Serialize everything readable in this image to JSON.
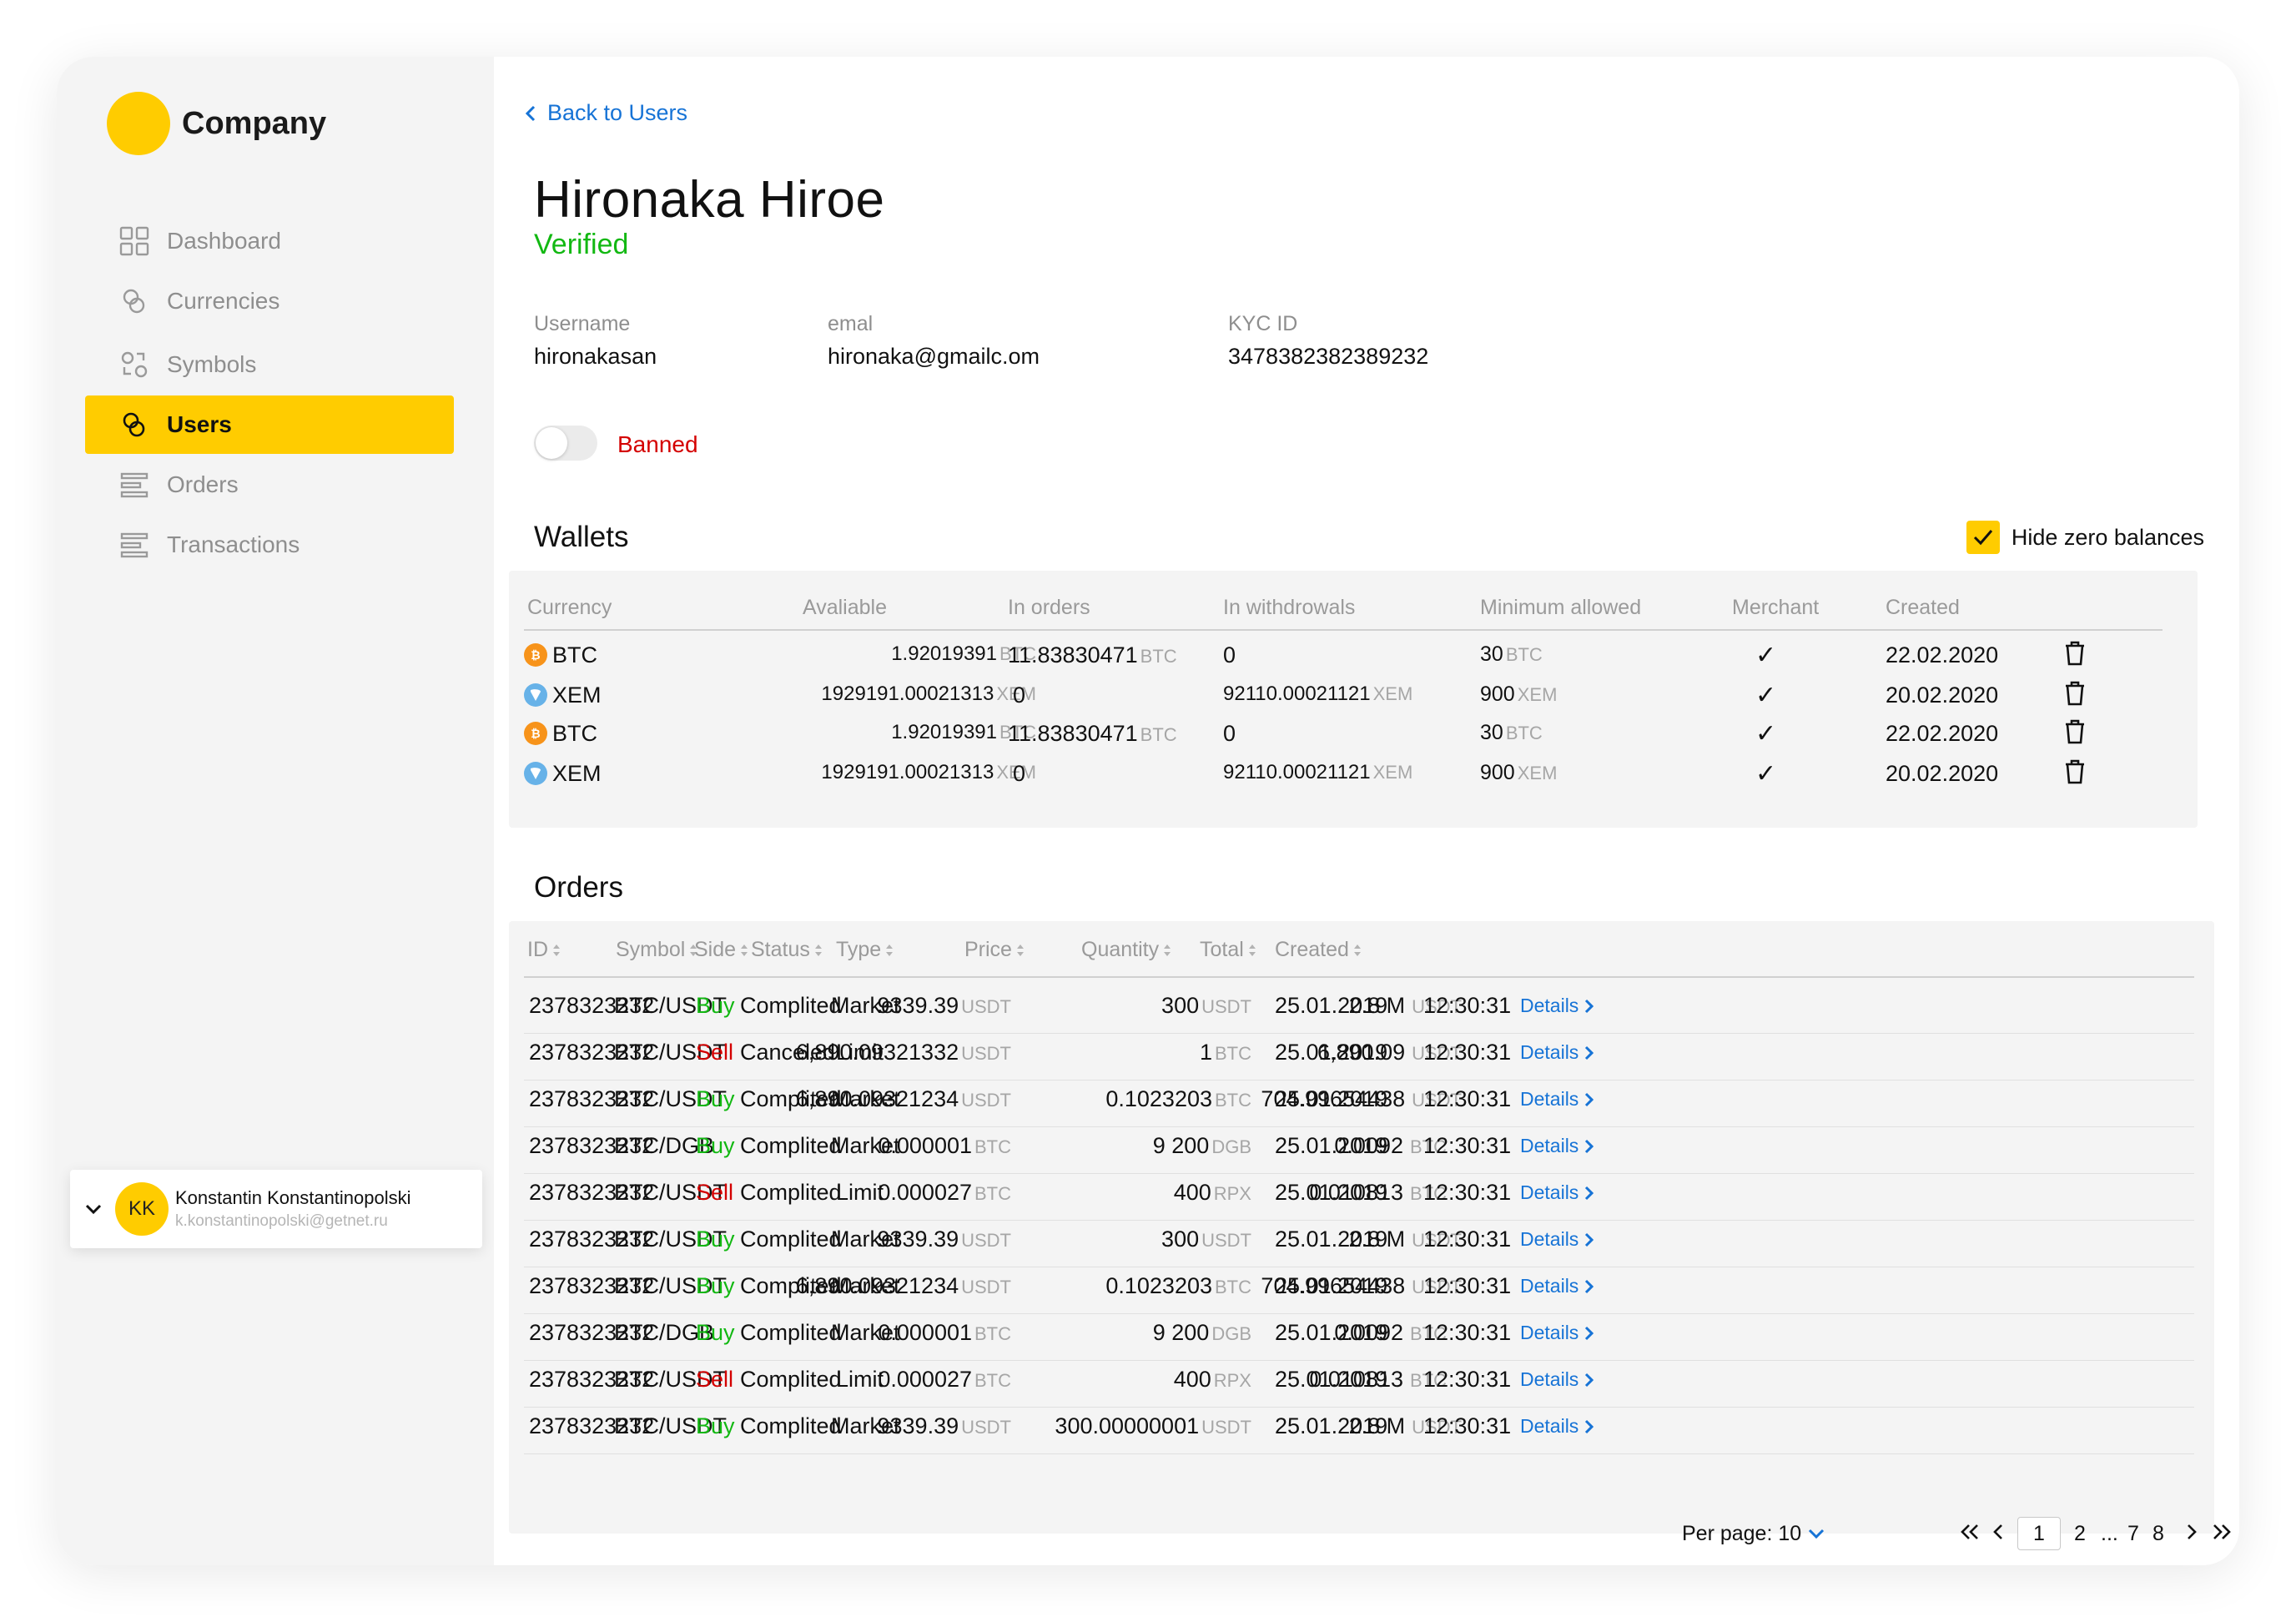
{
  "brand": {
    "name": "Company",
    "color": "#ffcc00"
  },
  "nav": [
    {
      "label": "Dashboard",
      "icon": "dashboard-icon",
      "active": false
    },
    {
      "label": "Currencies",
      "icon": "currencies-icon",
      "active": false
    },
    {
      "label": "Symbols",
      "icon": "symbols-icon",
      "active": false
    },
    {
      "label": "Users",
      "icon": "users-icon",
      "active": true
    },
    {
      "label": "Orders",
      "icon": "orders-icon",
      "active": false
    },
    {
      "label": "Transactions",
      "icon": "transactions-icon",
      "active": false
    }
  ],
  "current_user": {
    "initials": "KK",
    "name": "Konstantin Konstantinopolski",
    "email": "k.konstantinopolski@getnet.ru"
  },
  "header": {
    "back_label": "Back to Users",
    "user_name": "Hironaka Hiroe",
    "status": "Verified"
  },
  "info": {
    "username_label": "Username",
    "username_value": "hironakasan",
    "email_label": "emal",
    "email_value": "hironaka@gmailc.om",
    "kyc_label": "KYC ID",
    "kyc_value": "3478382382389232"
  },
  "banned": {
    "label": "Banned",
    "on": false
  },
  "wallets": {
    "title": "Wallets",
    "hide_zero_label": "Hide zero balances",
    "hide_zero_checked": true,
    "columns": [
      "Currency",
      "Avaliable",
      "In orders",
      "In withdrowals",
      "Minimum allowed",
      "Merchant",
      "Created"
    ],
    "rows": [
      {
        "coin": "BTC",
        "available": "1.92019391",
        "available_unit": "BTC",
        "in_orders": "11.83830471",
        "in_orders_unit": "BTC",
        "withdrawals": "0",
        "withdrawals_unit": "",
        "minimum": "30",
        "minimum_unit": "BTC",
        "merchant": "✓",
        "created": "22.02.2020"
      },
      {
        "coin": "XEM",
        "available": "1929191.00021313",
        "available_unit": "XEM",
        "in_orders": "0",
        "in_orders_unit": "",
        "withdrawals": "92110.00021121",
        "withdrawals_unit": "XEM",
        "minimum": "900",
        "minimum_unit": "XEM",
        "merchant": "✓",
        "created": "20.02.2020"
      },
      {
        "coin": "BTC",
        "available": "1.92019391",
        "available_unit": "BTC",
        "in_orders": "11.83830471",
        "in_orders_unit": "BTC",
        "withdrawals": "0",
        "withdrawals_unit": "",
        "minimum": "30",
        "minimum_unit": "BTC",
        "merchant": "✓",
        "created": "22.02.2020"
      },
      {
        "coin": "XEM",
        "available": "1929191.00021313",
        "available_unit": "XEM",
        "in_orders": "0",
        "in_orders_unit": "",
        "withdrawals": "92110.00021121",
        "withdrawals_unit": "XEM",
        "minimum": "900",
        "minimum_unit": "XEM",
        "merchant": "✓",
        "created": "20.02.2020"
      }
    ]
  },
  "orders": {
    "title": "Orders",
    "columns": [
      "ID",
      "Symbol",
      "Side",
      "Status",
      "Type",
      "Price",
      "Quantity",
      "Total",
      "Created"
    ],
    "details_label": "Details",
    "rows": [
      {
        "id": "2378323232",
        "symbol": "BTC/USDT",
        "side": "Buy",
        "status": "Complited",
        "type": "Market",
        "price": "9339.39",
        "price_unit": "USDT",
        "qty": "300",
        "qty_unit": "USDT",
        "total": "2.8 M",
        "total_unit": "USDT",
        "date": "25.01.2019",
        "time": "12:30:31"
      },
      {
        "id": "2378323232",
        "symbol": "BTC/USDT",
        "side": "Sell",
        "status": "Canceled",
        "type": "Limit",
        "price": "6,890.09321332",
        "price_unit": "USDT",
        "qty": "1",
        "qty_unit": "BTC",
        "total": "6,890.09",
        "total_unit": "USDT",
        "date": "25.01.2019",
        "time": "12:30:31"
      },
      {
        "id": "2378323232",
        "symbol": "BTC/USDT",
        "side": "Buy",
        "status": "Complited",
        "type": "Market",
        "price": "6,890.09321234",
        "price_unit": "USDT",
        "qty": "0.1023203",
        "qty_unit": "BTC",
        "total": "704.99654438",
        "total_unit": "USDT",
        "date": "25.01.2019",
        "time": "12:30:31"
      },
      {
        "id": "2378323232",
        "symbol": "BTC/DGB",
        "side": "Buy",
        "status": "Complited",
        "type": "Market",
        "price": "0.000001",
        "price_unit": "BTC",
        "qty": "9 200",
        "qty_unit": "DGB",
        "total": "0.0092",
        "total_unit": "BTC",
        "date": "25.01.2019",
        "time": "12:30:31"
      },
      {
        "id": "2378323232",
        "symbol": "BTC/USDT",
        "side": "Sell",
        "status": "Complited",
        "type": "Limit",
        "price": "0.000027",
        "price_unit": "BTC",
        "qty": "400",
        "qty_unit": "RPX",
        "total": "0.010813",
        "total_unit": "BTC",
        "date": "25.01.2019",
        "time": "12:30:31"
      },
      {
        "id": "2378323232",
        "symbol": "BTC/USDT",
        "side": "Buy",
        "status": "Complited",
        "type": "Market",
        "price": "9339.39",
        "price_unit": "USDT",
        "qty": "300",
        "qty_unit": "USDT",
        "total": "2.8 M",
        "total_unit": "USDT",
        "date": "25.01.2019",
        "time": "12:30:31"
      },
      {
        "id": "2378323232",
        "symbol": "BTC/USDT",
        "side": "Buy",
        "status": "Complited",
        "type": "Market",
        "price": "6,890.09321234",
        "price_unit": "USDT",
        "qty": "0.1023203",
        "qty_unit": "BTC",
        "total": "704.99654438",
        "total_unit": "USDT",
        "date": "25.01.2019",
        "time": "12:30:31"
      },
      {
        "id": "2378323232",
        "symbol": "BTC/DGB",
        "side": "Buy",
        "status": "Complited",
        "type": "Market",
        "price": "0.000001",
        "price_unit": "BTC",
        "qty": "9 200",
        "qty_unit": "DGB",
        "total": "0.0092",
        "total_unit": "BTC",
        "date": "25.01.2019",
        "time": "12:30:31"
      },
      {
        "id": "2378323232",
        "symbol": "BTC/USDT",
        "side": "Sell",
        "status": "Complited",
        "type": "Limit",
        "price": "0.000027",
        "price_unit": "BTC",
        "qty": "400",
        "qty_unit": "RPX",
        "total": "0.010813",
        "total_unit": "BTC",
        "date": "25.01.2019",
        "time": "12:30:31"
      },
      {
        "id": "2378323232",
        "symbol": "BTC/USDT",
        "side": "Buy",
        "status": "Complited",
        "type": "Market",
        "price": "9339.39",
        "price_unit": "USDT",
        "qty": "300.00000001",
        "qty_unit": "USDT",
        "total": "2.8 M",
        "total_unit": "USDT",
        "date": "25.01.2019",
        "time": "12:30:31"
      }
    ]
  },
  "pagination": {
    "per_page_label": "Per page:",
    "per_page_value": "10",
    "current": "1",
    "pages": [
      "2",
      "...",
      "7",
      "8"
    ]
  },
  "colors": {
    "accent": "#ffcc00",
    "link": "#1673d6",
    "buy": "#12b812",
    "sell": "#d40000",
    "verified": "#12b812"
  }
}
